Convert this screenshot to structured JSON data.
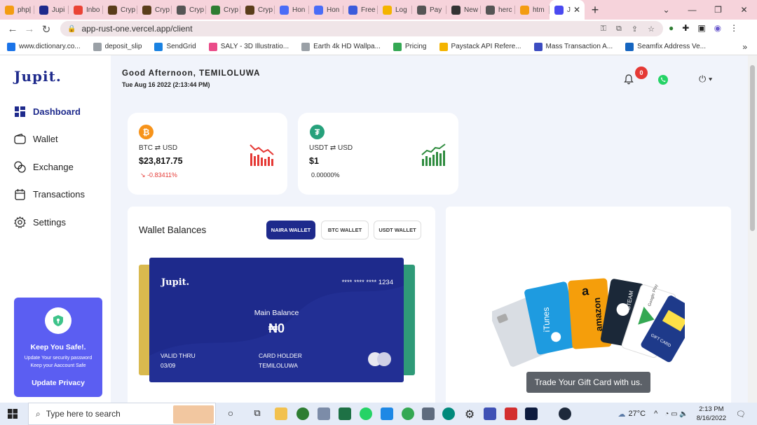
{
  "browser": {
    "tabs": [
      {
        "label": "php|",
        "color": "#f39c12"
      },
      {
        "label": "Jupi",
        "color": "#1e2a8c"
      },
      {
        "label": "Inbo",
        "color": "#ea4335"
      },
      {
        "label": "Cryp",
        "color": "#5a3d1a"
      },
      {
        "label": "Cryp",
        "color": "#5a3d1a"
      },
      {
        "label": "Cryp",
        "color": "#555555"
      },
      {
        "label": "Cryp",
        "color": "#2e7d32"
      },
      {
        "label": "Cryp",
        "color": "#5a3d1a"
      },
      {
        "label": "Hon",
        "color": "#4a6cf7"
      },
      {
        "label": "Hon",
        "color": "#4a6cf7"
      },
      {
        "label": "Free",
        "color": "#3b5bdb"
      },
      {
        "label": "Log",
        "color": "#f4b400"
      },
      {
        "label": "Pay",
        "color": "#555555"
      },
      {
        "label": "New",
        "color": "#333333"
      },
      {
        "label": "herc",
        "color": "#555555"
      },
      {
        "label": "htm",
        "color": "#f39c12"
      },
      {
        "label": "J",
        "color": "#4a4af0",
        "active": true
      }
    ],
    "url": "app-rust-one.vercel.app/client",
    "bookmarks": [
      {
        "label": "www.dictionary.co...",
        "color": "#1a73e8"
      },
      {
        "label": "deposit_slip",
        "color": "#9aa0a6"
      },
      {
        "label": "SendGrid",
        "color": "#1a82e2"
      },
      {
        "label": "SALY - 3D Illustratio...",
        "color": "#ea4c89"
      },
      {
        "label": "Earth 4k HD Wallpa...",
        "color": "#9aa0a6"
      },
      {
        "label": "Pricing",
        "color": "#34a853"
      },
      {
        "label": "Paystack API Refere...",
        "color": "#f4b400"
      },
      {
        "label": "Mass Transaction A...",
        "color": "#3c4cc1"
      },
      {
        "label": "Seamfix Address Ve...",
        "color": "#1565c0"
      }
    ]
  },
  "sidebar": {
    "logo": "Jupit.",
    "items": [
      {
        "label": "Dashboard",
        "icon": "dashboard-icon",
        "active": true
      },
      {
        "label": "Wallet",
        "icon": "wallet-icon"
      },
      {
        "label": "Exchange",
        "icon": "exchange-icon"
      },
      {
        "label": "Transactions",
        "icon": "transactions-icon"
      },
      {
        "label": "Settings",
        "icon": "settings-icon"
      }
    ],
    "safe": {
      "title": "Keep You Safe!.",
      "line1": "Update Your security password",
      "line2": "Keep your Aaccount Safe",
      "button": "Update Privacy"
    }
  },
  "header": {
    "greeting": "Good Afternoon, TEMILOLUWA",
    "datetime": "Tue Aug 16 2022 (2:13:44 PM)",
    "notifications": "0"
  },
  "rates": [
    {
      "pair_from": "BTC",
      "pair_sep": "⇄",
      "pair_to": "USD",
      "price": "$23,817.75",
      "change": "-0.83411%",
      "trend": "down",
      "color": "#e53935",
      "coin_color": "#f7931a",
      "coin_symbol": "₿"
    },
    {
      "pair_from": "USDT",
      "pair_sep": "⇄",
      "pair_to": "USD",
      "price": "$1",
      "change": "0.00000%",
      "trend": "up",
      "color": "#2e8b3e",
      "coin_color": "#26a17b",
      "coin_symbol": "₮"
    }
  ],
  "wallet": {
    "title": "Wallet Balances",
    "tabs": [
      "NAIRA WALLET",
      "BTC WALLET",
      "USDT WALLET"
    ],
    "card": {
      "logo": "Jupit.",
      "number": "**** **** **** 1234",
      "balance_label": "Main Balance",
      "balance": "₦0",
      "valid_label": "VALID THRU",
      "valid_value": "03/09",
      "holder_label": "CARD HOLDER",
      "holder_value": "TEMILOLUWA"
    }
  },
  "giftcard": {
    "button": "Trade Your Gift Card with us.",
    "cards": [
      "iTunes",
      "amazon",
      "STEAM",
      "Google Play",
      "GIFT CARD"
    ]
  },
  "taskbar": {
    "search_placeholder": "Type here to search",
    "weather": "27°C",
    "time": "2:13 PM",
    "date": "8/16/2022"
  }
}
